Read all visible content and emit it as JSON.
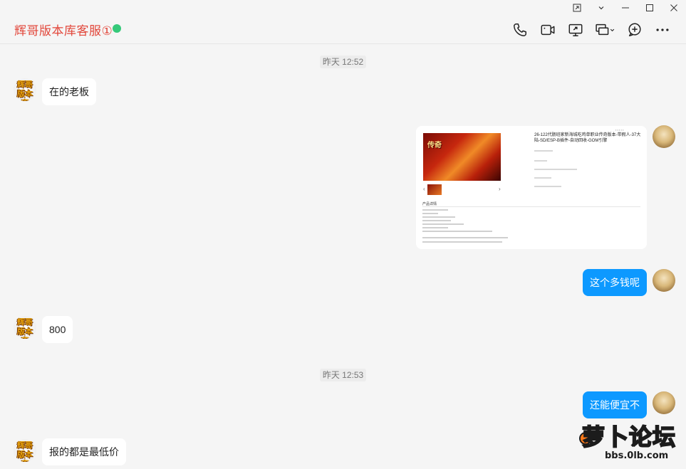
{
  "header": {
    "contact_name": "辉哥版本库客服①",
    "online_color": "#36c97a"
  },
  "window_controls": [
    "pin-icon",
    "chevron-down-icon",
    "minimize-icon",
    "maximize-icon",
    "close-icon"
  ],
  "toolbar": [
    "phone-icon",
    "video-call-icon",
    "screen-share-icon",
    "remote-assist-icon",
    "add-member-icon",
    "more-icon"
  ],
  "time_separators": [
    "昨天 12:52",
    "昨天 12:53"
  ],
  "avatars": {
    "shop_logo_text": "辉哥版本库"
  },
  "messages": [
    {
      "side": "left",
      "text": "在的老板"
    },
    {
      "side": "right",
      "type": "image"
    },
    {
      "side": "right",
      "text": "这个多钱呢"
    },
    {
      "side": "left",
      "text": "800"
    },
    {
      "side": "right",
      "text": "还能便宜不"
    },
    {
      "side": "left",
      "text": "报的都是最低价"
    }
  ],
  "image_card": {
    "product_title": "26-122代肠班家新海城吃鸡单职业传奇版本-带假人-37大陆-SD/ESP-B插件-自动回收-GOM引擎",
    "desc_heading": "产品详情"
  },
  "watermark": {
    "main": "萝卜论坛",
    "sub": "bbs.0lb.com"
  },
  "colors": {
    "right_bubble": "#0d99ff",
    "name_color": "#e2463a"
  }
}
